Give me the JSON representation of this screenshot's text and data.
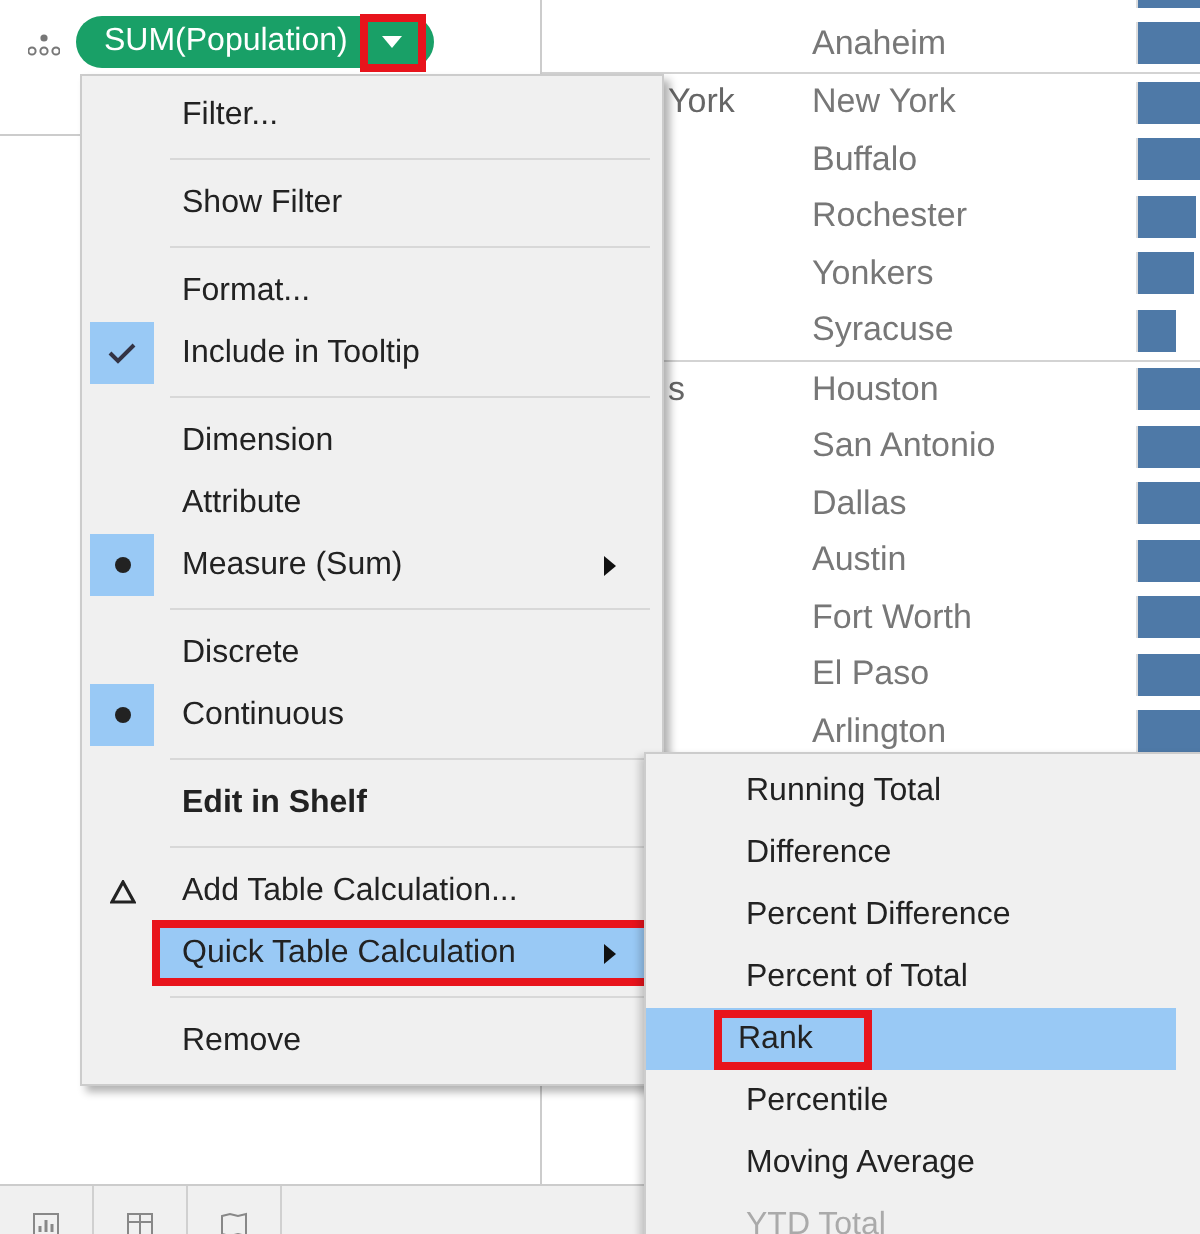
{
  "shelf": {
    "pill": {
      "label": "SUM(Population)",
      "dropdown_annotated": true
    }
  },
  "view": {
    "groups": [
      {
        "rows": [
          {
            "level": 1
          },
          {
            "city": "Anaheim",
            "level": 1
          }
        ]
      },
      {
        "state": "York",
        "rows": [
          {
            "city": "New York",
            "level": 1
          },
          {
            "city": "Buffalo",
            "level": 1
          },
          {
            "city": "Rochester",
            "level": 0.94
          },
          {
            "city": "Yonkers",
            "level": 0.9
          },
          {
            "city": "Syracuse",
            "level": 0.62
          }
        ]
      },
      {
        "state": "s",
        "rows": [
          {
            "city": "Houston",
            "level": 1
          },
          {
            "city": "San Antonio",
            "level": 1
          },
          {
            "city": "Dallas",
            "level": 1
          },
          {
            "city": "Austin",
            "level": 1
          },
          {
            "city": "Fort Worth",
            "level": 1
          },
          {
            "city": "El Paso",
            "level": 1
          },
          {
            "city": "Arlington",
            "level": 1
          }
        ]
      }
    ]
  },
  "context_menu": {
    "items": [
      {
        "kind": "item",
        "label": "Filter...",
        "selected": false,
        "checked": false
      },
      {
        "kind": "separator"
      },
      {
        "kind": "item",
        "label": "Show Filter",
        "selected": false,
        "checked": false
      },
      {
        "kind": "separator"
      },
      {
        "kind": "item",
        "label": "Format...",
        "selected": false,
        "checked": false
      },
      {
        "kind": "check",
        "label": "Include in Tooltip",
        "selected": false,
        "checked": true
      },
      {
        "kind": "separator"
      },
      {
        "kind": "item",
        "label": "Dimension",
        "selected": false,
        "checked": false
      },
      {
        "kind": "item",
        "label": "Attribute",
        "selected": false,
        "checked": false
      },
      {
        "kind": "radio",
        "label": "Measure (Sum)",
        "selected": false,
        "checked": true,
        "submenu": true
      },
      {
        "kind": "separator"
      },
      {
        "kind": "item",
        "label": "Discrete",
        "selected": false,
        "checked": false
      },
      {
        "kind": "radio",
        "label": "Continuous",
        "selected": false,
        "checked": true
      },
      {
        "kind": "separator"
      },
      {
        "kind": "item",
        "label": "Edit in Shelf",
        "selected": false,
        "checked": false,
        "bold": true
      },
      {
        "kind": "separator"
      },
      {
        "kind": "calc",
        "label": "Add Table Calculation...",
        "selected": false,
        "checked": false
      },
      {
        "kind": "item",
        "label": "Quick Table Calculation",
        "selected": true,
        "checked": false,
        "submenu": true,
        "annotated": true
      },
      {
        "kind": "separator"
      },
      {
        "kind": "item",
        "label": "Remove",
        "selected": false,
        "checked": false
      }
    ]
  },
  "submenu": {
    "items": [
      {
        "label": "Running Total",
        "selected": false,
        "disabled": false
      },
      {
        "label": "Difference",
        "selected": false,
        "disabled": false
      },
      {
        "label": "Percent Difference",
        "selected": false,
        "disabled": false
      },
      {
        "label": "Percent of Total",
        "selected": false,
        "disabled": false
      },
      {
        "label": "Rank",
        "selected": true,
        "disabled": false,
        "annotated": true
      },
      {
        "label": "Percentile",
        "selected": false,
        "disabled": false
      },
      {
        "label": "Moving Average",
        "selected": false,
        "disabled": false
      },
      {
        "label": "YTD Total",
        "selected": false,
        "disabled": true
      }
    ]
  }
}
